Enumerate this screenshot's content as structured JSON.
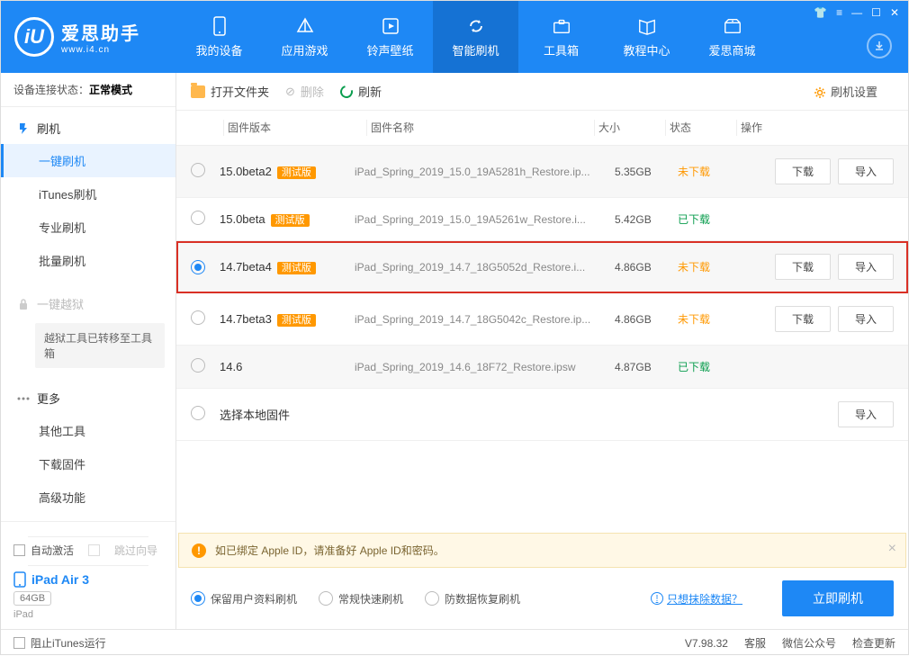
{
  "brand": {
    "title": "爱思助手",
    "sub": "www.i4.cn"
  },
  "nav": [
    "我的设备",
    "应用游戏",
    "铃声壁纸",
    "智能刷机",
    "工具箱",
    "教程中心",
    "爱思商城"
  ],
  "connStatus": {
    "label": "设备连接状态：",
    "value": "正常模式"
  },
  "sidebar": {
    "flash": {
      "head": "刷机",
      "items": [
        "一键刷机",
        "iTunes刷机",
        "专业刷机",
        "批量刷机"
      ]
    },
    "jailbreak": {
      "head": "一键越狱",
      "note": "越狱工具已转移至工具箱"
    },
    "more": {
      "head": "更多",
      "items": [
        "其他工具",
        "下载固件",
        "高级功能"
      ]
    }
  },
  "bottomChecks": {
    "autoActivate": "自动激活",
    "skipGuide": "跳过向导"
  },
  "device": {
    "name": "iPad Air 3",
    "storage": "64GB",
    "model": "iPad"
  },
  "toolbar": {
    "open": "打开文件夹",
    "delete": "删除",
    "refresh": "刷新",
    "settings": "刷机设置"
  },
  "table": {
    "headers": {
      "version": "固件版本",
      "name": "固件名称",
      "size": "大小",
      "status": "状态",
      "ops": "操作"
    },
    "rows": [
      {
        "ver": "15.0beta2",
        "beta": "测试版",
        "name": "iPad_Spring_2019_15.0_19A5281h_Restore.ip...",
        "size": "5.35GB",
        "status": "未下载",
        "statusCls": "st-orange",
        "ops": [
          "下载",
          "导入"
        ],
        "sel": false,
        "alt": true
      },
      {
        "ver": "15.0beta",
        "beta": "测试版",
        "name": "iPad_Spring_2019_15.0_19A5261w_Restore.i...",
        "size": "5.42GB",
        "status": "已下载",
        "statusCls": "st-green",
        "ops": [],
        "sel": false,
        "alt": false
      },
      {
        "ver": "14.7beta4",
        "beta": "测试版",
        "name": "iPad_Spring_2019_14.7_18G5052d_Restore.i...",
        "size": "4.86GB",
        "status": "未下载",
        "statusCls": "st-orange",
        "ops": [
          "下载",
          "导入"
        ],
        "sel": true,
        "alt": true,
        "highlight": true
      },
      {
        "ver": "14.7beta3",
        "beta": "测试版",
        "name": "iPad_Spring_2019_14.7_18G5042c_Restore.ip...",
        "size": "4.86GB",
        "status": "未下载",
        "statusCls": "st-orange",
        "ops": [
          "下载",
          "导入"
        ],
        "sel": false,
        "alt": false
      },
      {
        "ver": "14.6",
        "beta": "",
        "name": "iPad_Spring_2019_14.6_18F72_Restore.ipsw",
        "size": "4.87GB",
        "status": "已下载",
        "statusCls": "st-green",
        "ops": [],
        "sel": false,
        "alt": true
      },
      {
        "ver": "选择本地固件",
        "beta": "",
        "name": "",
        "size": "",
        "status": "",
        "statusCls": "",
        "ops": [
          "导入"
        ],
        "sel": false,
        "alt": false
      }
    ]
  },
  "alert": "如已绑定 Apple ID，请准备好 Apple ID和密码。",
  "options": [
    "保留用户资料刷机",
    "常规快速刷机",
    "防数据恢复刷机"
  ],
  "eraseLink": "只想抹除数据？",
  "flashNow": "立即刷机",
  "statusbar": {
    "blockItunes": "阻止iTunes运行",
    "version": "V7.98.32",
    "service": "客服",
    "wechat": "微信公众号",
    "update": "检查更新"
  }
}
